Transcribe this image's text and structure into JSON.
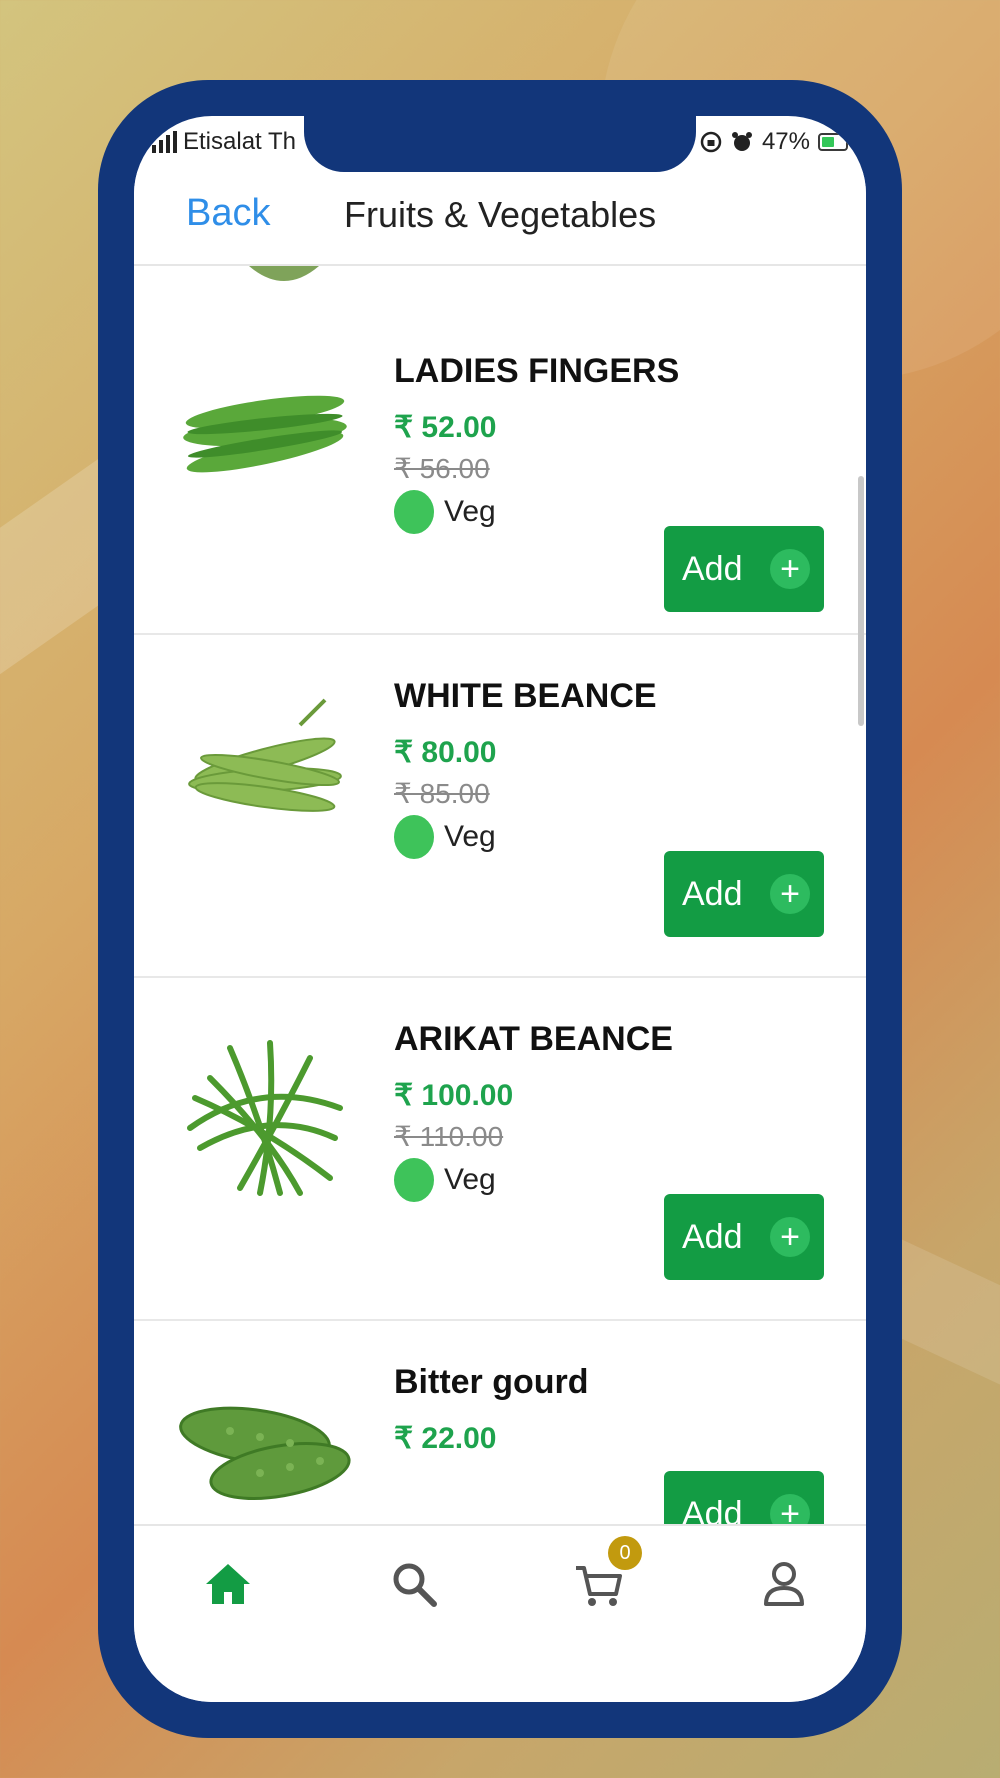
{
  "status_bar": {
    "carrier": "Etisalat Th",
    "battery": "47%"
  },
  "header": {
    "back_label": "Back",
    "title": "Fruits & Vegetables"
  },
  "products": [
    {
      "name": "LADIES FINGERS",
      "price": "₹ 52.00",
      "mrp": "₹ 56.00",
      "tag": "Veg",
      "add_label": "Add"
    },
    {
      "name": "WHITE BEANCE",
      "price": "₹ 80.00",
      "mrp": "₹ 85.00",
      "tag": "Veg",
      "add_label": "Add"
    },
    {
      "name": "ARIKAT BEANCE",
      "price": "₹ 100.00",
      "mrp": "₹ 110.00",
      "tag": "Veg",
      "add_label": "Add"
    },
    {
      "name": "Bitter gourd",
      "price": "₹ 22.00",
      "add_label": "Add"
    }
  ],
  "tabbar": {
    "cart_count": "0"
  },
  "colors": {
    "phone_frame": "#12367a",
    "accent_green": "#139c44",
    "price_green": "#1ea34d",
    "link_blue": "#2f8ee8",
    "badge": "#c29a0e"
  },
  "icons": [
    "home-icon",
    "search-icon",
    "cart-icon",
    "profile-icon",
    "plus-icon",
    "alarm-icon",
    "lock-rotation-icon",
    "battery-icon",
    "signal-icon"
  ]
}
